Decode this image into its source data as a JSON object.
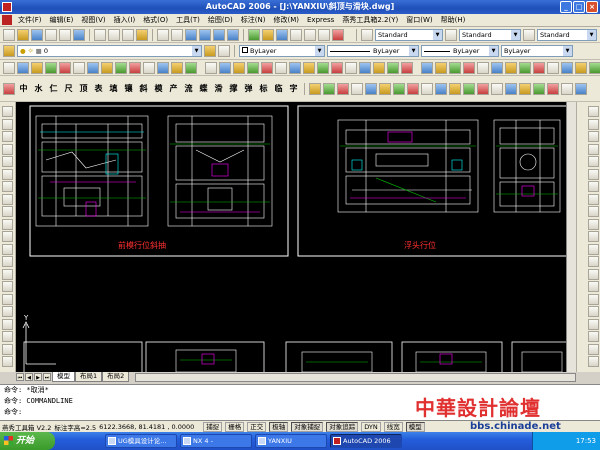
{
  "window": {
    "title": "AutoCAD 2006 - [J:\\YANXIU\\斜顶与滑块.dwg]"
  },
  "menu": [
    "文件(F)",
    "编辑(E)",
    "视图(V)",
    "插入(I)",
    "格式(O)",
    "工具(T)",
    "绘图(D)",
    "标注(N)",
    "修改(M)",
    "Express",
    "燕秀工具箱2.2(Y)",
    "窗口(W)",
    "帮助(H)"
  ],
  "toolbar_std": {
    "text_style": "Standard",
    "dim_style": "Standard",
    "table_style": "Standard"
  },
  "toolbar_layers": {
    "layer_value": "0",
    "color": "ByLayer",
    "linetype": "ByLayer",
    "lineweight": "ByLayer",
    "plotstyle": "ByLayer"
  },
  "yanxiu_toolbar": [
    "中",
    "水",
    "仁",
    "尺",
    "顶",
    "表",
    "填",
    "镶",
    "斜",
    "模",
    "产",
    "流",
    "蝶",
    "滑",
    "撑",
    "弹",
    "标",
    "临",
    "字"
  ],
  "drawing": {
    "label_left": "前模行位斜抽",
    "label_right": "浮头行位",
    "ucs_y": "Y"
  },
  "layout_tabs": [
    "模型",
    "布局1",
    "布局2"
  ],
  "command": {
    "line1": "命令: *取消*",
    "line2": "命令: COMMANDLINE",
    "line3": "命令:"
  },
  "status": {
    "app": "燕秀工具箱 V2.2",
    "text_height": "标注字高=2.5",
    "coords": "6122.3668, 81.4181 , 0.0000",
    "toggles": [
      "捕捉",
      "栅格",
      "正交",
      "极轴",
      "对象捕捉",
      "对象追踪",
      "DYN",
      "线宽",
      "模型"
    ],
    "toggles_on": [
      3,
      4,
      5,
      8
    ]
  },
  "watermark": {
    "title": "中華設計論壇",
    "url": "bbs.chinade.net"
  },
  "taskbar": {
    "start": "开始",
    "tasks": [
      "UG模具设计论...",
      "NX 4 -",
      "YANXIU",
      "AutoCAD 2006"
    ],
    "clock": "17:53"
  },
  "colors": {
    "canvas": "#000000",
    "drawing_line": "#ffffff",
    "label": "#ff3030",
    "detail_green": "#00c000",
    "detail_magenta": "#ff00ff",
    "detail_cyan": "#00ffff"
  }
}
